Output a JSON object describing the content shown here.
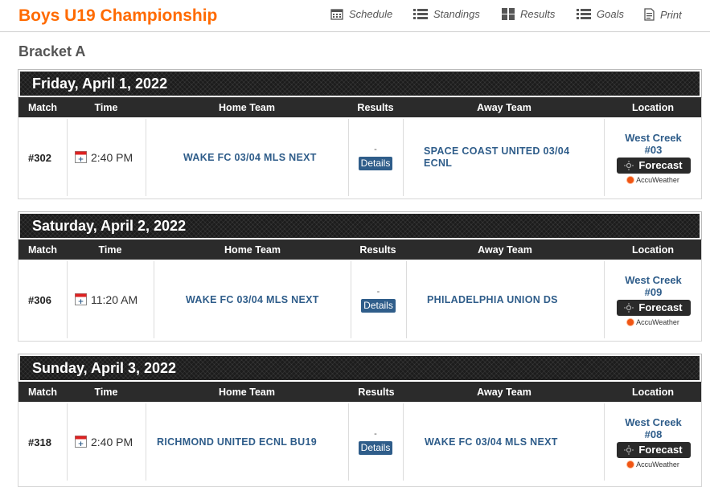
{
  "title": "Boys U19 Championship",
  "nav": {
    "schedule": "Schedule",
    "standings": "Standings",
    "results": "Results",
    "goals": "Goals",
    "print": "Print"
  },
  "bracket": "Bracket A",
  "columns": {
    "match": "Match",
    "time": "Time",
    "home": "Home Team",
    "results": "Results",
    "away": "Away Team",
    "location": "Location"
  },
  "labels": {
    "dash": "-",
    "details": "Details",
    "forecast": "Forecast",
    "accuweather": "AccuWeather"
  },
  "days": [
    {
      "date": "Friday, April 1, 2022",
      "match": "#302",
      "time": "2:40 PM",
      "home": "WAKE FC 03/04 MLS NEXT",
      "away": "SPACE COAST UNITED 03/04 ECNL",
      "location_line1": "West Creek",
      "location_line2": "#03"
    },
    {
      "date": "Saturday, April 2, 2022",
      "match": "#306",
      "time": "11:20 AM",
      "home": "WAKE FC 03/04 MLS NEXT",
      "away": "PHILADELPHIA UNION DS",
      "location_line1": "West Creek",
      "location_line2": "#09"
    },
    {
      "date": "Sunday, April 3, 2022",
      "match": "#318",
      "time": "2:40 PM",
      "home": "RICHMOND UNITED ECNL BU19",
      "away": "WAKE FC 03/04 MLS NEXT",
      "location_line1": "West Creek",
      "location_line2": "#08"
    }
  ],
  "colors": {
    "title": "#ff6a00",
    "link": "#2f5d8a",
    "header_dark": "#1c1c1c",
    "accuweather": "#f05514"
  }
}
